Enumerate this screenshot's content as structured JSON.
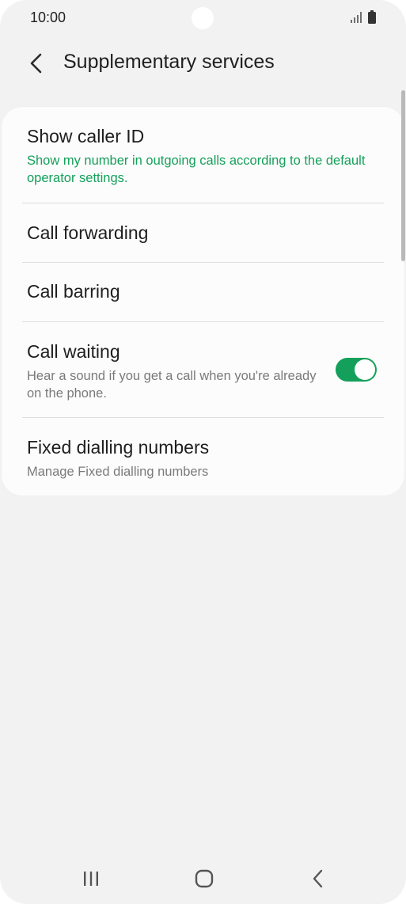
{
  "status_bar": {
    "time": "10:00",
    "icons": [
      "signal-icon",
      "battery-icon"
    ]
  },
  "header": {
    "back_icon": "chevron-left-icon",
    "title": "Supplementary services"
  },
  "settings": {
    "show_caller_id": {
      "title": "Show caller ID",
      "subtitle": "Show my number in outgoing calls according to the default operator settings."
    },
    "call_forwarding": {
      "title": "Call forwarding"
    },
    "call_barring": {
      "title": "Call barring"
    },
    "call_waiting": {
      "title": "Call waiting",
      "subtitle": "Hear a sound if you get a call when you're already on the phone.",
      "enabled": true
    },
    "fixed_dialling_numbers": {
      "title": "Fixed dialling numbers",
      "subtitle": "Manage Fixed dialling numbers"
    }
  },
  "colors": {
    "accent": "#14a05a",
    "background": "#f2f2f2",
    "card": "#fcfcfc"
  },
  "nav_bar": {
    "icons": [
      "recent-apps-icon",
      "home-icon",
      "back-icon"
    ]
  }
}
